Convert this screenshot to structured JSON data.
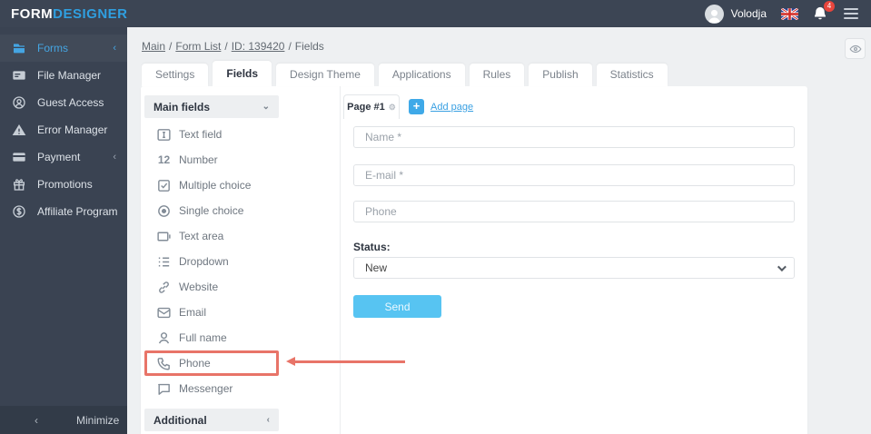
{
  "topbar": {
    "logo_form": "FORM",
    "logo_designer": "DESIGNER",
    "user_name": "Volodja",
    "notification_count": "4"
  },
  "sidebar": {
    "items": [
      {
        "label": "Forms",
        "icon": "forms-icon",
        "active": true,
        "has_chevron": true
      },
      {
        "label": "File Manager",
        "icon": "file-manager-icon"
      },
      {
        "label": "Guest Access",
        "icon": "guest-access-icon"
      },
      {
        "label": "Error Manager",
        "icon": "error-manager-icon"
      },
      {
        "label": "Payment",
        "icon": "payment-icon",
        "has_chevron": true
      },
      {
        "label": "Promotions",
        "icon": "promotions-icon"
      },
      {
        "label": "Affiliate Program",
        "icon": "affiliate-program-icon"
      }
    ],
    "minimize_label": "Minimize"
  },
  "breadcrumb": {
    "separator": "/",
    "links": [
      "Main",
      "Form List",
      "ID: 139420"
    ],
    "current": "Fields"
  },
  "tabs": [
    {
      "label": "Settings"
    },
    {
      "label": "Fields",
      "active": true
    },
    {
      "label": "Design Theme"
    },
    {
      "label": "Applications"
    },
    {
      "label": "Rules"
    },
    {
      "label": "Publish"
    },
    {
      "label": "Statistics"
    }
  ],
  "field_palette": {
    "main_header": "Main fields",
    "items": [
      {
        "label": "Text field",
        "icon": "text-field-icon"
      },
      {
        "label": "Number",
        "icon": "number-icon"
      },
      {
        "label": "Multiple choice",
        "icon": "multiple-choice-icon"
      },
      {
        "label": "Single choice",
        "icon": "single-choice-icon"
      },
      {
        "label": "Text area",
        "icon": "text-area-icon"
      },
      {
        "label": "Dropdown",
        "icon": "dropdown-icon"
      },
      {
        "label": "Website",
        "icon": "website-icon"
      },
      {
        "label": "Email",
        "icon": "email-icon"
      },
      {
        "label": "Full name",
        "icon": "full-name-icon"
      },
      {
        "label": "Phone",
        "icon": "phone-icon",
        "highlighted": true
      },
      {
        "label": "Messenger",
        "icon": "messenger-icon"
      }
    ],
    "additional_header": "Additional"
  },
  "form_builder": {
    "page_tab_label": "Page #1",
    "add_page_label": "Add page",
    "fields": [
      {
        "placeholder": "Name *"
      },
      {
        "placeholder": "E-mail *"
      },
      {
        "placeholder": "Phone"
      }
    ],
    "status_label": "Status:",
    "status_value": "New",
    "send_label": "Send"
  },
  "colors": {
    "topbar_bg": "#3c4554",
    "sidebar_bg": "#3a4352",
    "accent_blue": "#35a1e2",
    "send_button_blue": "#57c4f2",
    "highlight_red": "#e87468",
    "badge_red": "#e8453c",
    "page_bg": "#eef0f2"
  }
}
